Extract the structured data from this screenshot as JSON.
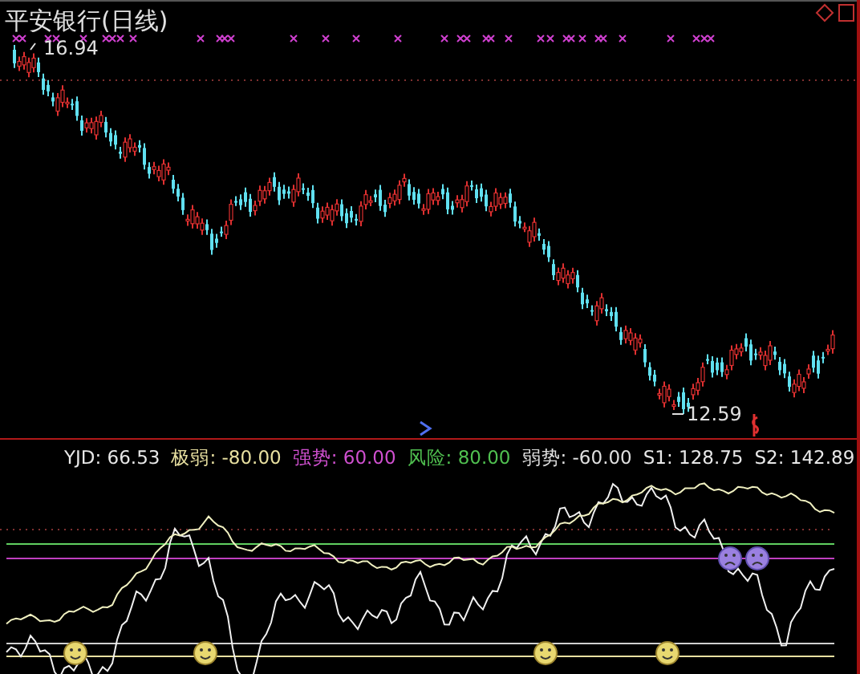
{
  "chart": {
    "title": "平安银行(日线)",
    "high_label": "16.94",
    "low_label": "12.59"
  },
  "legend": [
    {
      "text": "YJD: 66.53",
      "color": "#e8e8e8"
    },
    {
      "text": "极弱: -80.00",
      "color": "#e8e0a0"
    },
    {
      "text": "强势: 60.00",
      "color": "#d050d0"
    },
    {
      "text": "风险: 80.00",
      "color": "#50c050"
    },
    {
      "text": "弱势: -60.00",
      "color": "#e0e0e0"
    },
    {
      "text": "S1: 128.75",
      "color": "#e8e8e8"
    },
    {
      "text": "S2: 142.89",
      "color": "#e8e8e8"
    }
  ]
}
